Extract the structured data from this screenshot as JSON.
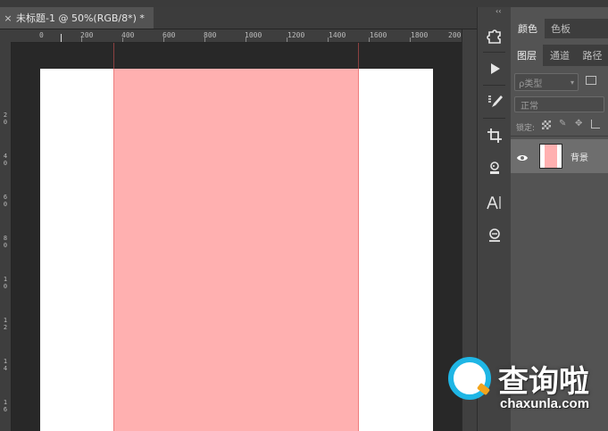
{
  "document_tab": {
    "close_label": "×",
    "title": "未标题-1 @ 50%(RGB/8*) *"
  },
  "ruler": {
    "top_labels": [
      "0",
      "200",
      "400",
      "600",
      "800",
      "1000",
      "1200",
      "1400",
      "1600",
      "1800",
      "200"
    ],
    "left_labels": [
      "2",
      "0",
      "4",
      "0",
      "6",
      "0",
      "8",
      "0",
      "1",
      "0",
      "1",
      "2",
      "1",
      "4",
      "1",
      "6"
    ]
  },
  "toolstrip": {
    "collapse_label": "‹‹",
    "tools": [
      {
        "name": "puzzle-icon"
      },
      {
        "name": "play-icon"
      },
      {
        "name": "brush-settings-icon"
      },
      {
        "name": "crop-icon"
      },
      {
        "name": "stamp-icon"
      },
      {
        "name": "text-cursor-icon"
      },
      {
        "name": "gradient-icon"
      }
    ]
  },
  "panel": {
    "tabs_top": [
      "颜色",
      "色板"
    ],
    "tabs_layers": [
      "图层",
      "通道",
      "路径"
    ],
    "filter": {
      "placeholder": "ρ类型"
    },
    "blend_mode": "正常",
    "lock_label": "锁定:",
    "layers": [
      {
        "name": "背景",
        "visible": true
      }
    ]
  },
  "canvas": {
    "zoom": "50%",
    "color_mode": "RGB/8*",
    "document_color": "#ffffff",
    "rect_color": "#ffb0b0"
  },
  "watermark": {
    "title": "查询啦",
    "url": "chaxunla.com",
    "brand_color": "#1fb6e5"
  }
}
